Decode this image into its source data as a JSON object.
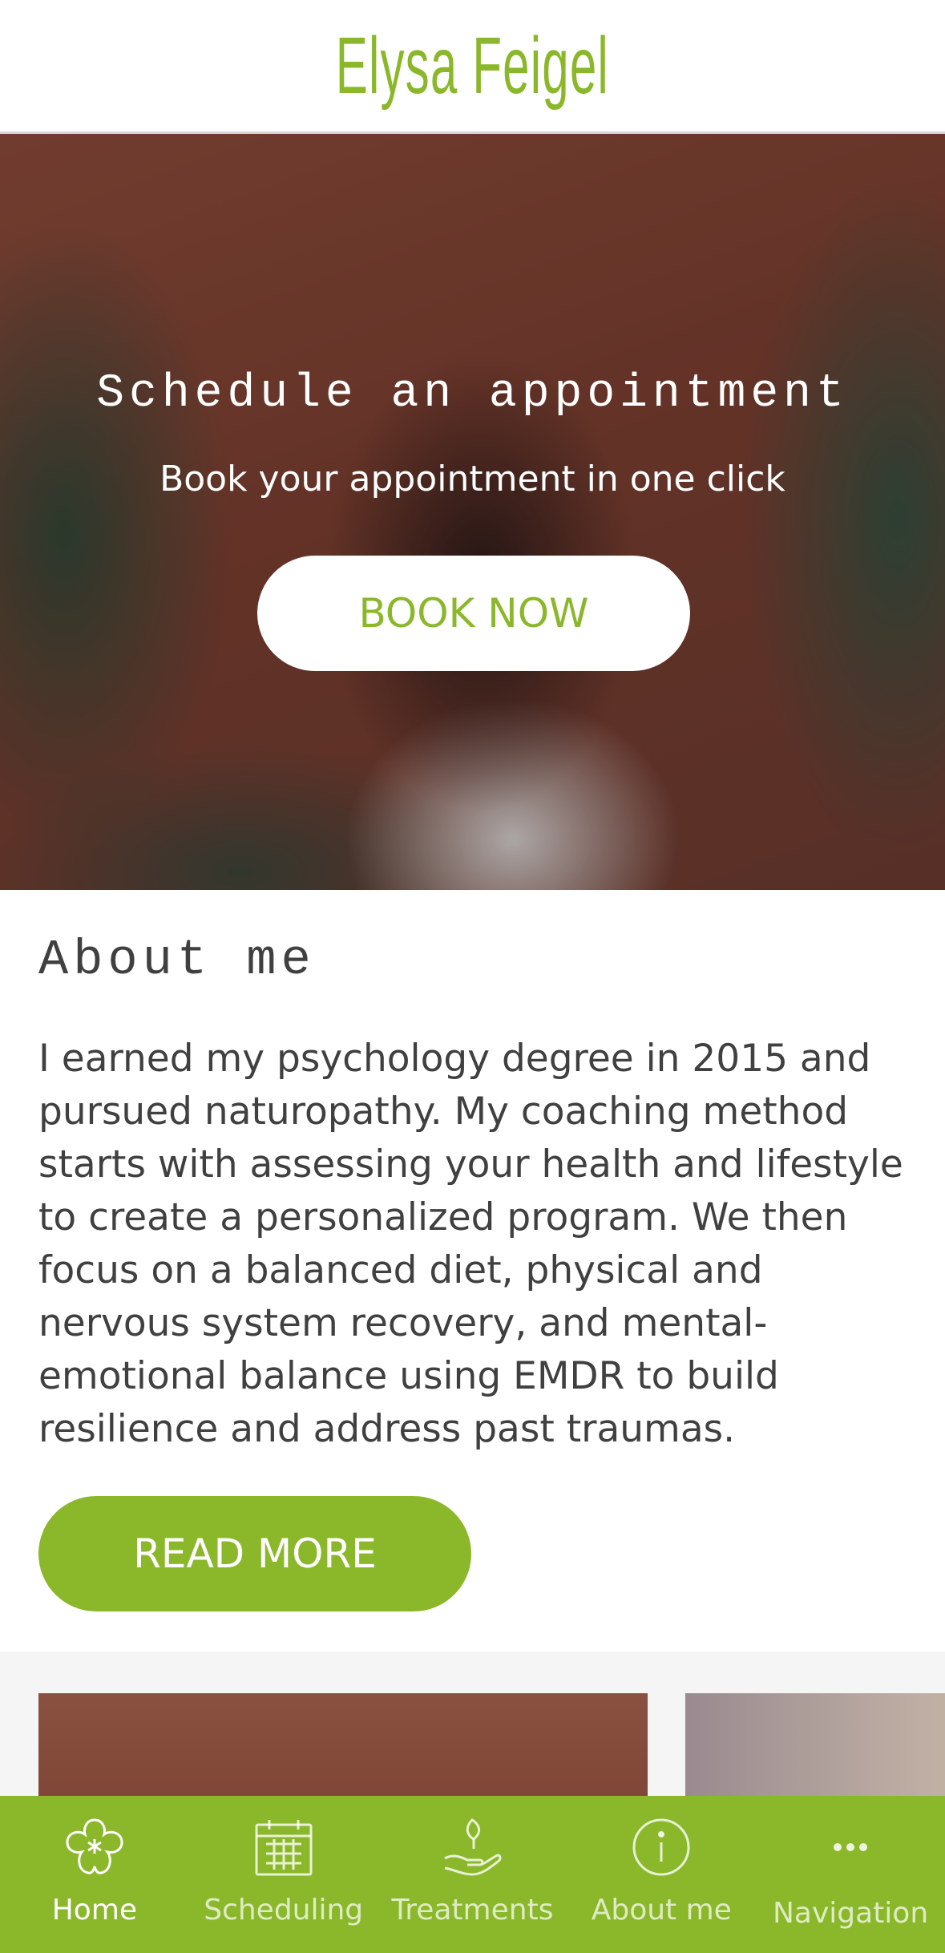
{
  "header": {
    "brand": "Elysa Feigel"
  },
  "hero": {
    "title": "Schedule an appointment",
    "subtitle": "Book your appointment in one click",
    "button_label": "BOOK NOW"
  },
  "about": {
    "title": "About me",
    "body": "I earned my psychology degree in 2015 and pursued naturopathy. My coaching method starts with assessing your health and lifestyle to create a personalized program. We then focus on a balanced diet, physical and nervous system recovery, and mental-emotional balance using EMDR to build resilience and address past traumas.",
    "button_label": "READ MORE"
  },
  "tabbar": {
    "items": [
      {
        "label": "Home",
        "icon": "flower-asterisk-icon",
        "active": true
      },
      {
        "label": "Scheduling",
        "icon": "calendar-icon",
        "active": false
      },
      {
        "label": "Treatments",
        "icon": "hand-leaf-icon",
        "active": false
      },
      {
        "label": "About me",
        "icon": "info-icon",
        "active": false
      },
      {
        "label": "Navigation",
        "icon": "more-dots-icon",
        "active": false
      }
    ]
  },
  "colors": {
    "accent": "#8bb82a",
    "text": "#404040",
    "background": "#ffffff"
  }
}
